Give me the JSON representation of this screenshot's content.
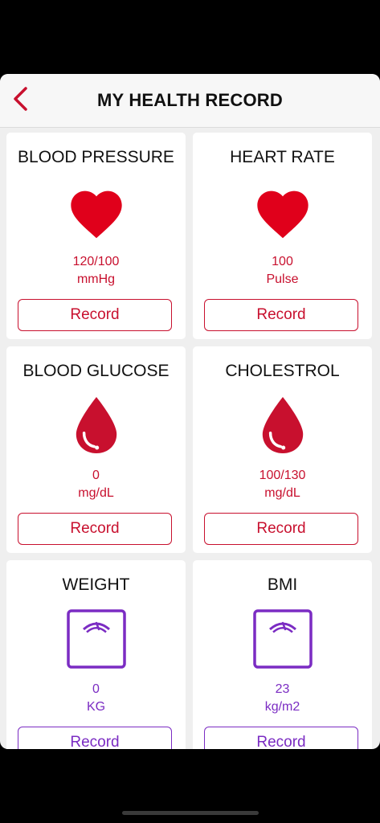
{
  "header": {
    "title": "MY HEALTH RECORD",
    "back_icon": "chevron-left-icon"
  },
  "colors": {
    "accent_red": "#c8102e",
    "accent_purple": "#7b2cc3",
    "heart_red": "#e0001b"
  },
  "cards": [
    {
      "title": "BLOOD PRESSURE",
      "icon": "heart-icon",
      "value": "120/100",
      "unit": "mmHg",
      "button": "Record"
    },
    {
      "title": "HEART RATE",
      "icon": "heart-icon",
      "value": "100",
      "unit": "Pulse",
      "button": "Record"
    },
    {
      "title": "BLOOD GLUCOSE",
      "icon": "blood-drop-icon",
      "value": "0",
      "unit": "mg/dL",
      "button": "Record"
    },
    {
      "title": "CHOLESTROL",
      "icon": "blood-drop-icon",
      "value": "100/130",
      "unit": "mg/dL",
      "button": "Record"
    },
    {
      "title": "WEIGHT",
      "icon": "scale-icon",
      "value": "0",
      "unit": "KG",
      "button": "Record"
    },
    {
      "title": "BMI",
      "icon": "scale-icon",
      "value": "23",
      "unit": "kg/m2",
      "button": "Record"
    }
  ]
}
